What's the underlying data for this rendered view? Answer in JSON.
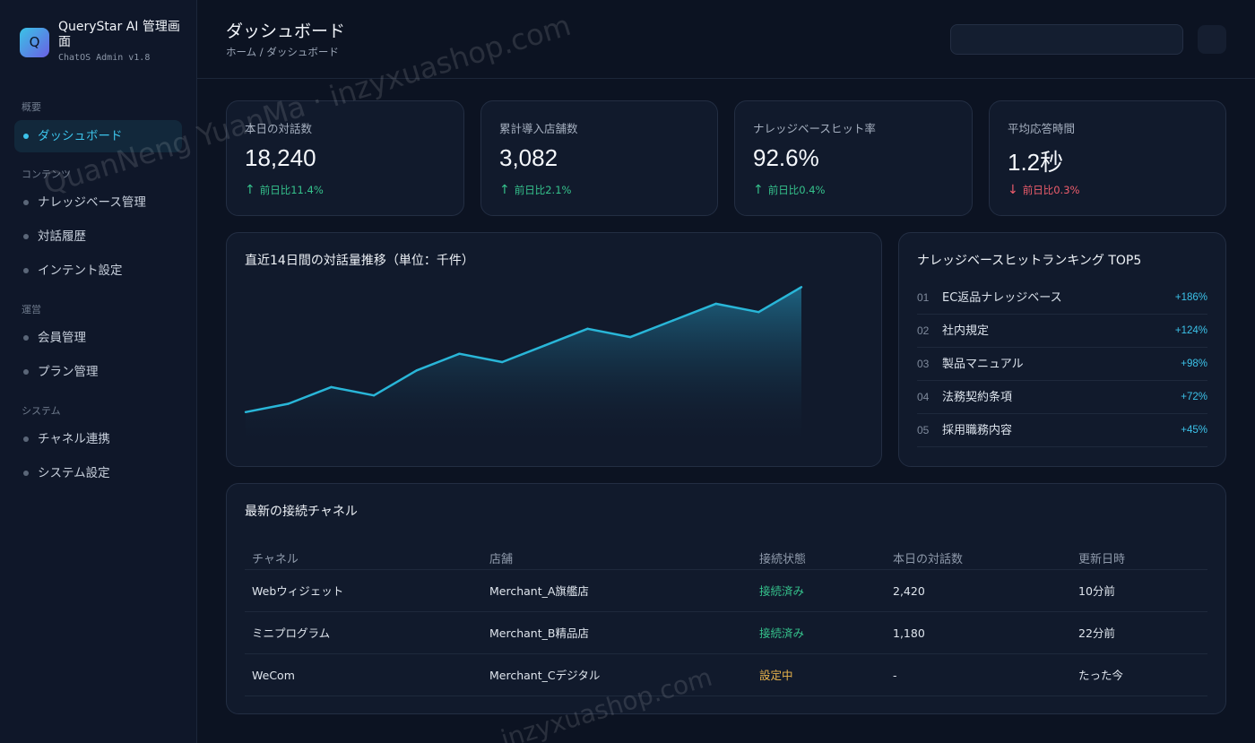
{
  "app": {
    "logo_letter": "Q",
    "title": "QueryStar AI 管理画面",
    "subtitle": "ChatOS Admin v1.8"
  },
  "sidebar": {
    "groups": [
      {
        "label": "概要",
        "items": [
          {
            "label": "ダッシュボード",
            "active": true
          }
        ]
      },
      {
        "label": "コンテンツ",
        "items": [
          {
            "label": "ナレッジベース管理"
          },
          {
            "label": "対話履歴"
          },
          {
            "label": "インテント設定"
          }
        ]
      },
      {
        "label": "運営",
        "items": [
          {
            "label": "会員管理"
          },
          {
            "label": "プラン管理"
          }
        ]
      },
      {
        "label": "システム",
        "items": [
          {
            "label": "チャネル連携"
          },
          {
            "label": "システム設定"
          }
        ]
      }
    ]
  },
  "header": {
    "title": "ダッシュボード",
    "breadcrumb": "ホーム / ダッシュボード"
  },
  "stats": [
    {
      "label": "本日の対話数",
      "value": "18,240",
      "arrow": "↑",
      "delta": "前日比11.4%",
      "trend": "up"
    },
    {
      "label": "累計導入店舗数",
      "value": "3,082",
      "arrow": "↑",
      "delta": "前日比2.1%",
      "trend": "up"
    },
    {
      "label": "ナレッジベースヒット率",
      "value": "92.6%",
      "arrow": "↑",
      "delta": "前日比0.4%",
      "trend": "up"
    },
    {
      "label": "平均応答時間",
      "value": "1.2秒",
      "arrow": "↓",
      "delta": "前日比0.3%",
      "trend": "down"
    }
  ],
  "trend_chart": {
    "title": "直近14日間の対話量推移（単位：千件）",
    "chart_data": {
      "type": "area",
      "x": [
        1,
        2,
        3,
        4,
        5,
        6,
        7,
        8,
        9,
        10,
        11,
        12,
        13,
        14
      ],
      "values": [
        8,
        10,
        14,
        12,
        18,
        22,
        20,
        24,
        28,
        26,
        30,
        34,
        32,
        38
      ],
      "title": "直近14日間の対話量推移（単位：千件）",
      "ylim": [
        0,
        40
      ],
      "grid": false,
      "color": "#29b6d8"
    }
  },
  "ranking": {
    "title": "ナレッジベースヒットランキング TOP5",
    "items": [
      {
        "num": "01",
        "name": "EC返品ナレッジベース",
        "delta": "+186%"
      },
      {
        "num": "02",
        "name": "社内規定",
        "delta": "+124%"
      },
      {
        "num": "03",
        "name": "製品マニュアル",
        "delta": "+98%"
      },
      {
        "num": "04",
        "name": "法務契約条項",
        "delta": "+72%"
      },
      {
        "num": "05",
        "name": "採用職務内容",
        "delta": "+45%"
      }
    ]
  },
  "channels": {
    "title": "最新の接続チャネル",
    "columns": [
      "チャネル",
      "店舗",
      "接続状態",
      "本日の対話数",
      "更新日時"
    ],
    "rows": [
      {
        "channel": "Webウィジェット",
        "store": "Merchant_A旗艦店",
        "status": "接続済み",
        "status_kind": "ok",
        "count": "2,420",
        "updated": "10分前"
      },
      {
        "channel": "ミニプログラム",
        "store": "Merchant_B精品店",
        "status": "接続済み",
        "status_kind": "ok",
        "count": "1,180",
        "updated": "22分前"
      },
      {
        "channel": "WeCom",
        "store": "Merchant_Cデジタル",
        "status": "設定中",
        "status_kind": "wait",
        "count": "-",
        "updated": "たった今"
      }
    ]
  },
  "watermark": {
    "text1": "QuanNeng YuanMa · inzyxuashop.com",
    "text2": "inzyxuashop.com"
  },
  "colors": {
    "accent": "#3cc3ea",
    "up": "#35c28c",
    "down": "#ee5d6c",
    "pending": "#e8b34b"
  }
}
